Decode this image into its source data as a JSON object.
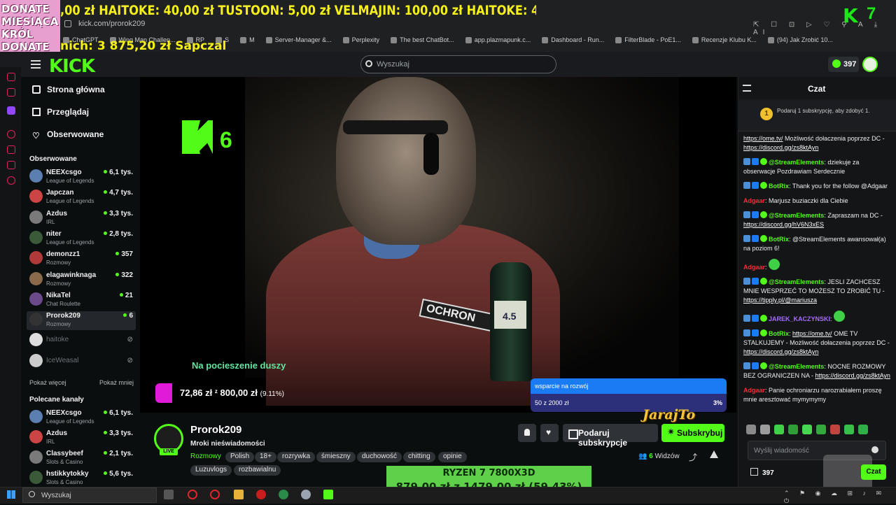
{
  "overlay": {
    "donate_box": "DONATE\nMIESIĄCA\nKRÓL\nDONATE",
    "ticker": ",00 zł HAITOKE: 40,00 zł TUSTOON: 5,00 zł VELMAJIN: 100,00 zł HAITOKE: 40,00 zł TUSTOON: 5,00 zł VELMAJIN: 100,0(",
    "donation_amount": "nich: 3 875,20 zł Sapczal",
    "kick_count": "7",
    "video_kick_count": "6",
    "caption": "Na pocieszenie duszy",
    "goal_left_text": "72,86 zł",
    "goal_left_z": "z",
    "goal_left_target": "800,00 zł",
    "goal_left_pct": "(9.11%)",
    "goal_right_title": "wsparcie na rozwój",
    "goal_right_amount": "50 z 2000 zł",
    "goal_right_pct": "3%",
    "goal_right_progress": 0.03,
    "jaraj_to": "JarajTo",
    "ryzen_line1": "RYZEN 7 7800X3D",
    "ryzen_line2": "879,00 zł z 1479,00 zł (59.43%)",
    "badge_text": "OCHRON",
    "bottle_text": "4.5"
  },
  "browser": {
    "url": "kick.com/prorok209",
    "bookmarks": [
      "ChatGPT",
      "Wing Man Challen...",
      "RP",
      "S",
      "M",
      "Server-Manager &...",
      "Perplexity",
      "The best ChatBot...",
      "app.plazmapunk.c...",
      "Dashboard - Run...",
      "FilterBlade - PoE1...",
      "Recenzje Klubu K...",
      "(94) Jak Zrobić 10..."
    ],
    "ext_icons": "⇱ ☐ ⊡ ▷ ♡ ⚲ A ⤓ AI"
  },
  "header": {
    "logo": "KICK",
    "search_placeholder": "Wyszukaj",
    "kicks_count": "397"
  },
  "sidebar": {
    "nav": [
      "Strona główna",
      "Przeglądaj",
      "Obserwowane"
    ],
    "followed_title": "Obserwowane",
    "followed": [
      {
        "name": "NEEXcsgo",
        "category": "League of Legends",
        "viewers": "6,1 tys."
      },
      {
        "name": "Japczan",
        "category": "League of Legends",
        "viewers": "4,7 tys."
      },
      {
        "name": "Azdus",
        "category": "IRL",
        "viewers": "3,3 tys."
      },
      {
        "name": "niter",
        "category": "League of Legends",
        "viewers": "2,8 tys."
      },
      {
        "name": "demonzz1",
        "category": "Rozmowy",
        "viewers": "357"
      },
      {
        "name": "elagawinknaga",
        "category": "Rozmowy",
        "viewers": "322"
      },
      {
        "name": "NikaTel",
        "category": "Chat Roulette",
        "viewers": "21"
      },
      {
        "name": "Prorok209",
        "category": "Rozmowy",
        "viewers": "6"
      },
      {
        "name": "haitoke",
        "category": "",
        "viewers": "⊘"
      },
      {
        "name": "IceWeasal",
        "category": "",
        "viewers": "⊘"
      }
    ],
    "show_more": "Pokaż więcej",
    "show_less": "Pokaż mniej",
    "recommended_title": "Polecane kanały",
    "recommended": [
      {
        "name": "NEEXcsgo",
        "category": "League of Legends",
        "viewers": "6,1 tys."
      },
      {
        "name": "Azdus",
        "category": "IRL",
        "viewers": "3,3 tys."
      },
      {
        "name": "Classybeef",
        "category": "Slots & Casino",
        "viewers": "2,1 tys."
      },
      {
        "name": "hstikkytokky",
        "category": "Slots & Casino",
        "viewers": "5,6 tys."
      }
    ]
  },
  "stream": {
    "channel": "Prorok209",
    "title": "Mroki nieświadomości",
    "category": "Rozmowy",
    "tags": [
      "Polish",
      "18+",
      "rozrywka",
      "śmieszny",
      "duchowość",
      "chitting",
      "opinie",
      "Luzuvlogs",
      "rozbawialnu"
    ],
    "live": "LIVE",
    "gift_label": "Podaruj subskrypcje",
    "subscribe_label": "Subskrybuj",
    "viewers_count": "6",
    "viewers_label": "Widzów"
  },
  "chat": {
    "title": "Czat",
    "gift_rank": "1",
    "gift_text": "Podaruj 1 subskrypcję, aby zdobyć 1.",
    "messages": [
      {
        "user": "",
        "color": "#ffffff",
        "text": "Możliwość dołaczenia poprzez DC -",
        "link1": "https://ome.tv/",
        "link2": "https://discord.gg/zs8ktAyn"
      },
      {
        "user": "@StreamElements",
        "color": "#53fc18",
        "text": "dziekuje za obserwacje Pozdrawiam Serdecznie",
        "link1": "",
        "link2": ""
      },
      {
        "user": "BotRix",
        "color": "#53fc18",
        "text": "Thank you for the follow @Adgaar",
        "link1": "",
        "link2": ""
      },
      {
        "user": "Adgaar",
        "color": "#e8343d",
        "text": "Marjusz buziaczki dla Ciebie",
        "link1": "",
        "link2": ""
      },
      {
        "user": "@StreamElements",
        "color": "#53fc18",
        "text": "Zapraszam na DC -",
        "link1": "",
        "link2": "https://discord.gg/hV6N3xES"
      },
      {
        "user": "BotRix",
        "color": "#53fc18",
        "text": "@StreamElements awansował(a) na poziom 6!",
        "link1": "",
        "link2": ""
      },
      {
        "user": "Adgaar",
        "color": "#e8343d",
        "text": "",
        "link1": "",
        "link2": ""
      },
      {
        "user": "@StreamElements",
        "color": "#53fc18",
        "text": "JESLI ZACHCESZ MNIE WESPRZEĆ TO MOŻESZ TO ZROBIĆ TU -",
        "link1": "",
        "link2": "https://tipply.pl/@mariusza"
      },
      {
        "user": "JAREK_KACZYNSKI",
        "color": "#a66cff",
        "text": "",
        "link1": "",
        "link2": ""
      },
      {
        "user": "BotRix",
        "color": "#53fc18",
        "text": "OME TV STALKUJEMY - Możliwość dołaczenia poprzez DC -",
        "link1": "https://ome.tv/",
        "link2": "https://discord.gg/zs8ktAyn"
      },
      {
        "user": "@StreamElements",
        "color": "#53fc18",
        "text": "NOCNE ROZMOWY BEZ OGRANICZEN NA -",
        "link1": "",
        "link2": "https://discord.gg/zs8ktAyn"
      },
      {
        "user": "Adgaar",
        "color": "#e8343d",
        "text": "Panie ochroniarzu narozrabiałem proszę mnie aresztować mymymymy",
        "link1": "",
        "link2": ""
      }
    ],
    "input_placeholder": "Wyślij wiadomość",
    "points": "397",
    "send_label": "Czat"
  },
  "taskbar": {
    "search_placeholder": "Wyszukaj",
    "tray": "⌃ ⚑ ◉ ☁ ⊞ ♪ ✉ ⏻"
  }
}
